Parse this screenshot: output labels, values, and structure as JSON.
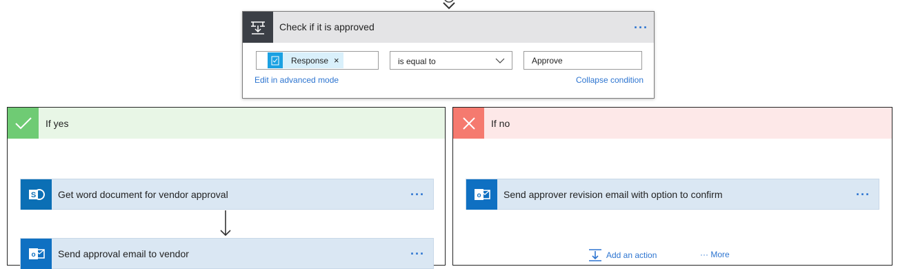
{
  "condition": {
    "title": "Check if it is approved",
    "token_label": "Response",
    "token_remove": "×",
    "operator": "is equal to",
    "value": "Approve",
    "edit_link": "Edit in advanced mode",
    "collapse_link": "Collapse condition",
    "more_dots": "···"
  },
  "if_yes": {
    "title": "If yes",
    "actions": [
      {
        "label": "Get word document for vendor approval",
        "icon": "sharepoint-icon",
        "dots": "···"
      },
      {
        "label": "Send approval email to vendor",
        "icon": "outlook-icon",
        "dots": "···"
      }
    ]
  },
  "if_no": {
    "title": "If no",
    "actions": [
      {
        "label": "Send approver revision email with option to confirm",
        "icon": "outlook-icon",
        "dots": "···"
      }
    ],
    "add_action": "Add an action",
    "more": "··· More"
  },
  "colors": {
    "accent": "#2c74d0",
    "yes": "#6fcb74",
    "no": "#f57a6f",
    "condition_icon_bg": "#3b3f46",
    "action_bg": "#dae7f3"
  }
}
